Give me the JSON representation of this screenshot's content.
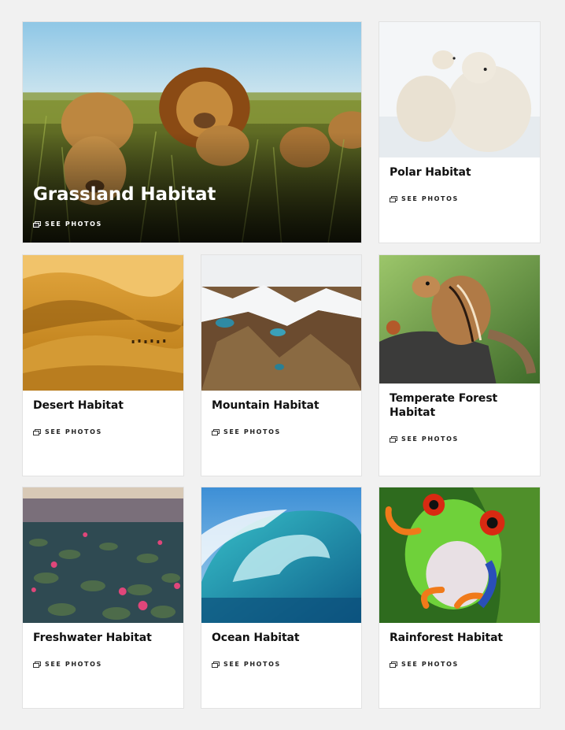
{
  "feature": {
    "title": "Grassland Habitat",
    "link_label": "SEE PHOTOS"
  },
  "cards": [
    {
      "id": "polar",
      "title": "Polar Habitat",
      "link_label": "SEE PHOTOS"
    },
    {
      "id": "desert",
      "title": "Desert Habitat",
      "link_label": "SEE PHOTOS"
    },
    {
      "id": "mountain",
      "title": "Mountain Habitat",
      "link_label": "SEE PHOTOS"
    },
    {
      "id": "temperate",
      "title": "Temperate Forest Habitat",
      "link_label": "SEE PHOTOS"
    },
    {
      "id": "freshwater",
      "title": "Freshwater Habitat",
      "link_label": "SEE PHOTOS"
    },
    {
      "id": "ocean",
      "title": "Ocean Habitat",
      "link_label": "SEE PHOTOS"
    },
    {
      "id": "rainforest",
      "title": "Rainforest Habitat",
      "link_label": "SEE PHOTOS"
    }
  ],
  "icons": {
    "see_photos": "gallery-icon"
  },
  "colors": {
    "page_background": "#f1f1f1",
    "card_background": "#ffffff",
    "title_text": "#111111"
  }
}
